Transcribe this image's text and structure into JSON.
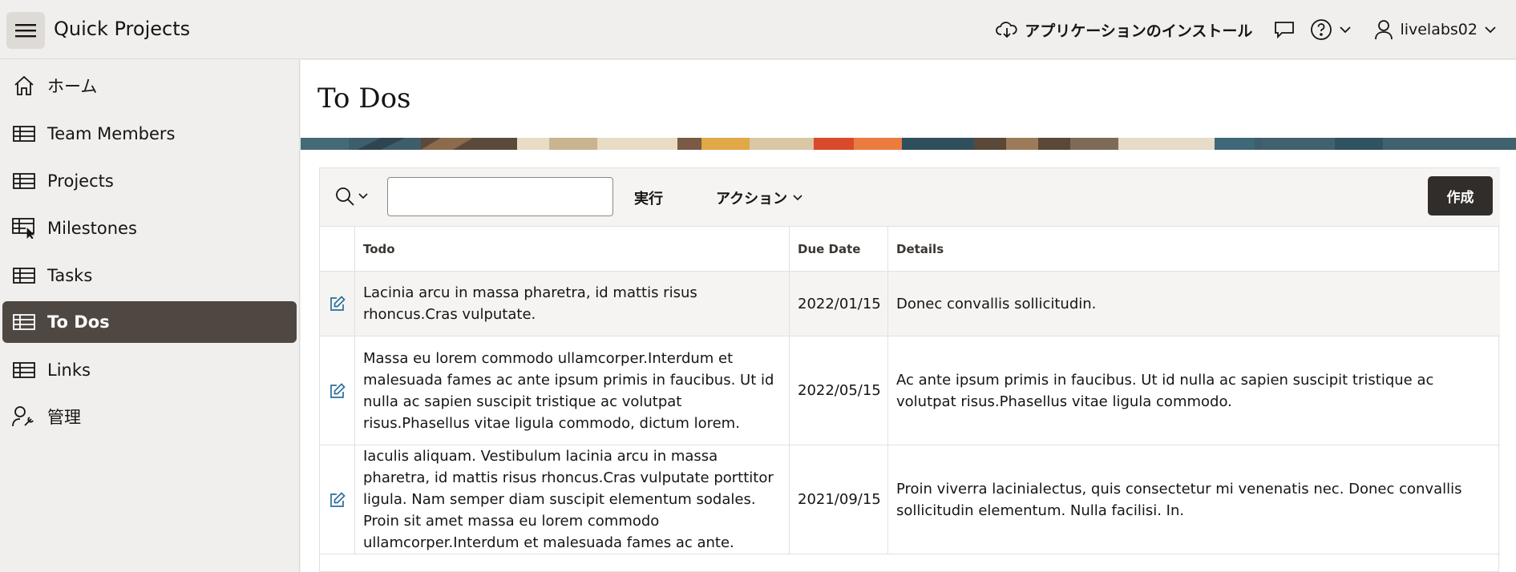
{
  "header": {
    "app_title": "Quick Projects",
    "install_label": "アプリケーションのインストール",
    "username": "livelabs02"
  },
  "sidebar": {
    "items": [
      {
        "label": "ホーム",
        "icon": "home-icon"
      },
      {
        "label": "Team Members",
        "icon": "table-icon"
      },
      {
        "label": "Projects",
        "icon": "table-icon"
      },
      {
        "label": "Milestones",
        "icon": "table-cursor-icon"
      },
      {
        "label": "Tasks",
        "icon": "table-icon"
      },
      {
        "label": "To Dos",
        "icon": "table-icon",
        "active": true
      },
      {
        "label": "Links",
        "icon": "table-icon"
      },
      {
        "label": "管理",
        "icon": "user-wrench-icon"
      }
    ]
  },
  "page": {
    "title": "To Dos"
  },
  "toolbar": {
    "search_value": "",
    "go_label": "実行",
    "actions_label": "アクション",
    "create_label": "作成"
  },
  "grid": {
    "columns": [
      "Todo",
      "Due Date",
      "Details"
    ],
    "rows": [
      {
        "todo": "Lacinia arcu in massa pharetra, id mattis risus rhoncus.Cras vulputate.",
        "due": "2022/01/15",
        "details": "Donec convallis sollicitudin."
      },
      {
        "todo": "Massa eu lorem commodo ullamcorper.Interdum et malesuada fames ac ante ipsum primis in faucibus. Ut id nulla ac sapien suscipit tristique ac volutpat risus.Phasellus vitae ligula commodo, dictum lorem.",
        "due": "2022/05/15",
        "details": "Ac ante ipsum primis in faucibus. Ut id nulla ac sapien suscipit tristique ac volutpat risus.Phasellus vitae ligula commodo."
      },
      {
        "todo": "Iaculis aliquam. Vestibulum lacinia arcu in massa pharetra, id mattis risus rhoncus.Cras vulputate porttitor ligula. Nam semper diam suscipit elementum sodales. Proin sit amet massa eu lorem commodo ullamcorper.Interdum et malesuada fames ac ante.",
        "due": "2021/09/15",
        "details": "Proin viverra lacinialectus, quis consectetur mi venenatis nec. Donec convallis sollicitudin elementum. Nulla facilisi. In."
      }
    ]
  },
  "colors": {
    "active_nav_bg": "#4f4842",
    "create_button_bg": "#312d2a",
    "edit_icon": "#2b6f9b"
  }
}
